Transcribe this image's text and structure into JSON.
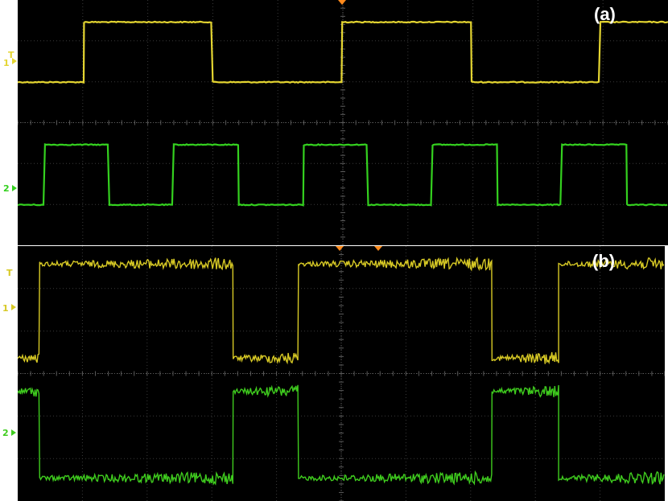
{
  "panels": [
    {
      "label": "(a)",
      "trigger_marker": "T",
      "channels": [
        {
          "marker": "1",
          "color": "#e4d531",
          "noise": 0.6,
          "levels": [
            0.33,
            0.82
          ],
          "segments": [
            [
              0,
              0
            ],
            [
              0.102,
              1
            ],
            [
              0.3,
              0
            ],
            [
              0.499,
              1
            ],
            [
              0.698,
              0
            ],
            [
              0.896,
              1
            ],
            [
              1.0,
              1
            ]
          ]
        },
        {
          "marker": "2",
          "color": "#34d11f",
          "noise": 0.6,
          "levels": [
            0.33,
            0.82
          ],
          "segments": [
            [
              0,
              0
            ],
            [
              0.042,
              1
            ],
            [
              0.141,
              0
            ],
            [
              0.24,
              1
            ],
            [
              0.34,
              0
            ],
            [
              0.44,
              1
            ],
            [
              0.539,
              0
            ],
            [
              0.638,
              1
            ],
            [
              0.738,
              0
            ],
            [
              0.837,
              1
            ],
            [
              0.937,
              0
            ],
            [
              1.0,
              0
            ]
          ]
        }
      ]
    },
    {
      "label": "(b)",
      "trigger_marker": "T",
      "channels": [
        {
          "marker": "1",
          "color": "#d7c925",
          "noise": 6,
          "levels": [
            0.12,
            0.86
          ],
          "segments": [
            [
              0,
              0
            ],
            [
              0.034,
              1
            ],
            [
              0.333,
              0
            ],
            [
              0.434,
              1
            ],
            [
              0.733,
              0
            ],
            [
              0.836,
              1
            ],
            [
              1.0,
              1
            ]
          ]
        },
        {
          "marker": "2",
          "color": "#3fcc1e",
          "noise": 6,
          "levels": [
            0.18,
            0.86
          ],
          "segments": [
            [
              0,
              1
            ],
            [
              0.034,
              0
            ],
            [
              0.333,
              1
            ],
            [
              0.434,
              0
            ],
            [
              0.733,
              1
            ],
            [
              0.836,
              0
            ],
            [
              1.0,
              0
            ]
          ]
        }
      ]
    }
  ]
}
